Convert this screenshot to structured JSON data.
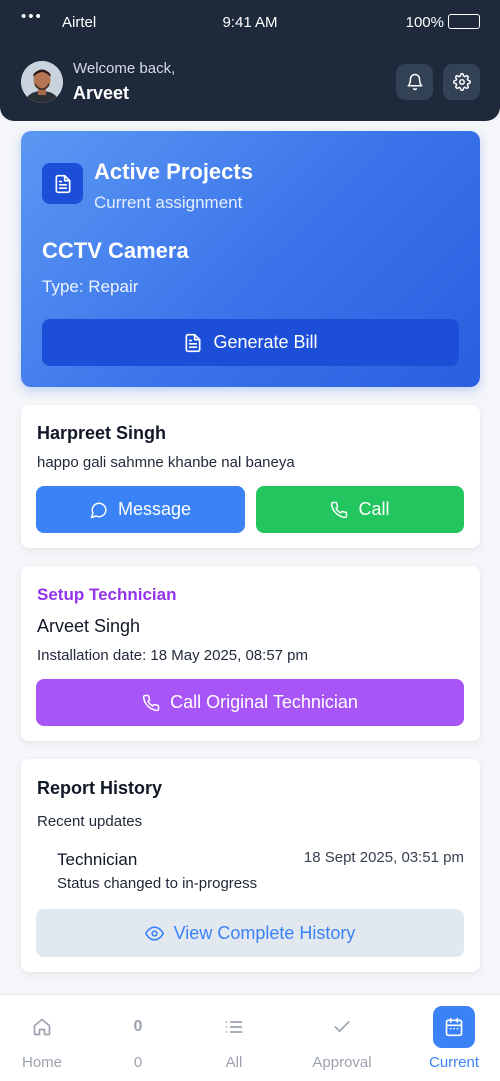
{
  "status_bar": {
    "dots": "•••",
    "carrier": "Airtel",
    "time": "9:41 AM",
    "battery": "100%"
  },
  "header": {
    "welcome": "Welcome back,",
    "user_name": "Arveet",
    "icons": [
      "bell-icon",
      "gear-icon"
    ]
  },
  "project": {
    "title": "Active Projects",
    "subtitle": "Current assignment",
    "name": "CCTV Camera",
    "type": "Type: Repair",
    "generate_bill_label": "Generate Bill"
  },
  "customer": {
    "name": "Harpreet Singh",
    "address": "happo gali sahmne khanbe nal baneya",
    "message_label": "Message",
    "call_label": "Call"
  },
  "technician": {
    "label": "Setup Technician",
    "name": "Arveet Singh",
    "installation": "Installation date: 18 May 2025, 08:57 pm",
    "call_label": "Call Original Technician"
  },
  "history": {
    "title": "Report History",
    "subtitle": "Recent updates",
    "entries": [
      {
        "who": "Technician",
        "time": "18 Sept 2025, 03:51 pm",
        "status": "Status changed to in-progress"
      }
    ],
    "view_all_label": "View Complete History"
  },
  "nav": {
    "items": [
      {
        "label": "Home",
        "icon": "home-icon"
      },
      {
        "label": "0",
        "count": "0"
      },
      {
        "label": "All",
        "icon": "list-icon"
      },
      {
        "label": "Approval",
        "icon": "check-icon"
      },
      {
        "label": "Current",
        "icon": "calendar-icon",
        "active": true
      }
    ]
  },
  "colors": {
    "header_bg": "#1e293b",
    "project_gradient_start": "#5b98f3",
    "project_gradient_end": "#2a5fe0",
    "primary": "#3b82f6",
    "success": "#22c55e",
    "purple": "#a855f7",
    "purple_text": "#9333ea"
  }
}
